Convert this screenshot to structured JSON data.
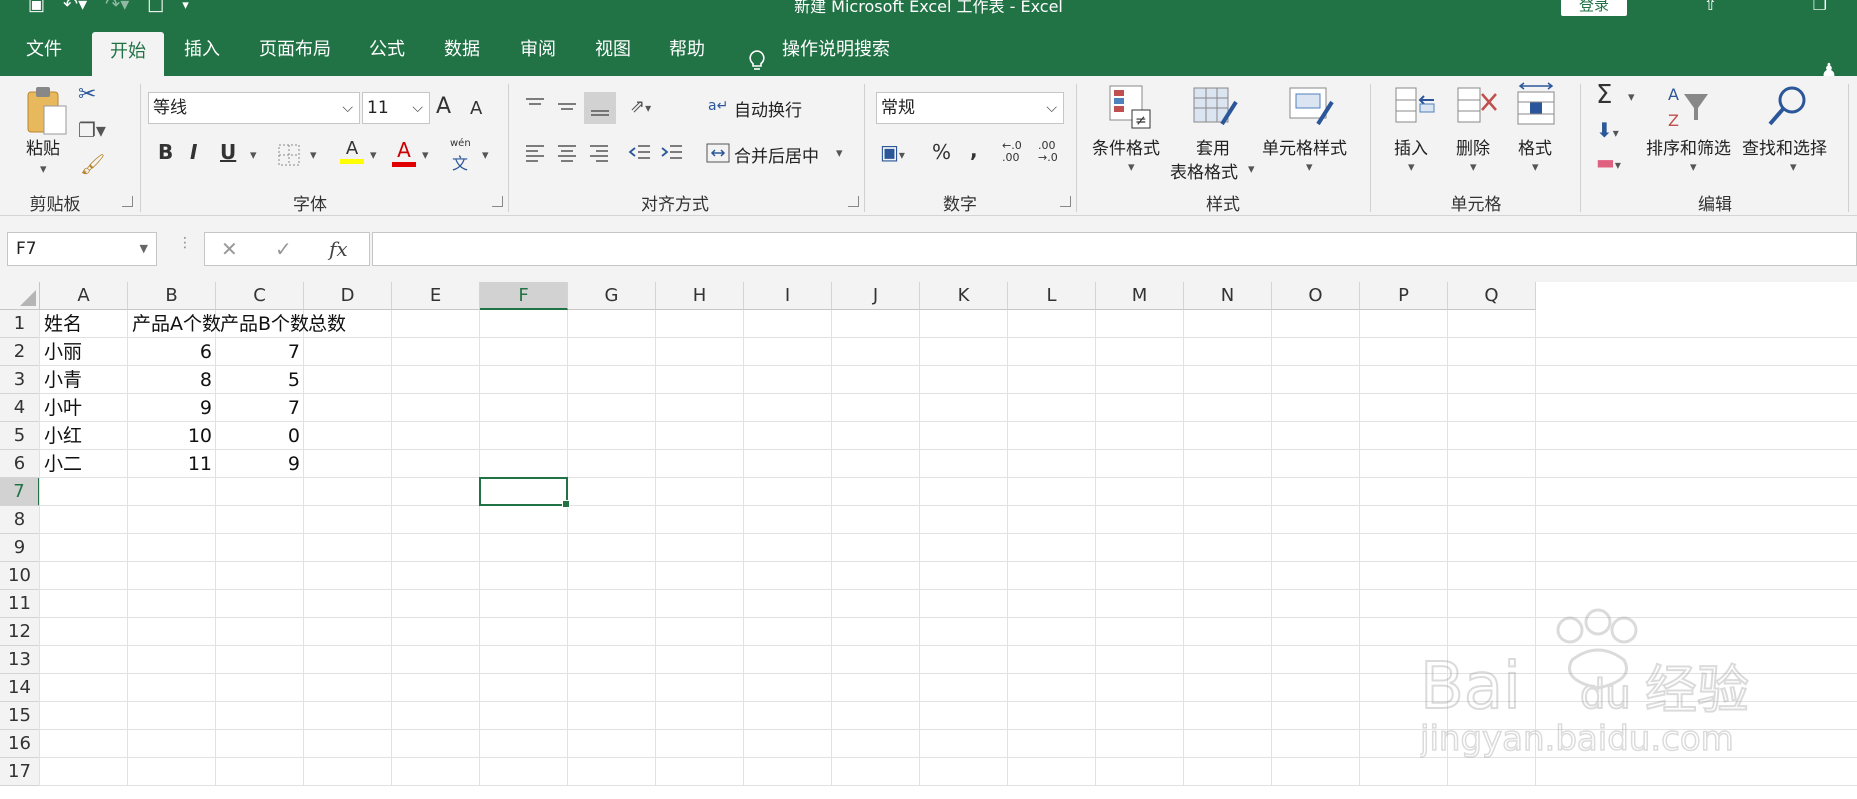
{
  "window": {
    "title": "新建 Microsoft Excel 工作表  -  Excel",
    "login_label": "登录"
  },
  "tabs": [
    {
      "label": "文件"
    },
    {
      "label": "开始"
    },
    {
      "label": "插入"
    },
    {
      "label": "页面布局"
    },
    {
      "label": "公式"
    },
    {
      "label": "数据"
    },
    {
      "label": "审阅"
    },
    {
      "label": "视图"
    },
    {
      "label": "帮助"
    },
    {
      "label": "操作说明搜索"
    }
  ],
  "active_tab": "开始",
  "ribbon": {
    "clipboard": {
      "paste": "粘贴",
      "group": "剪贴板"
    },
    "font": {
      "name": "等线",
      "size": "11",
      "grow": "A",
      "shrink": "A",
      "bold": "B",
      "italic": "I",
      "underline": "U",
      "fill": "A",
      "color": "A",
      "phonetic_top": "wén",
      "phonetic": "文",
      "group": "字体"
    },
    "alignment": {
      "wrap": "自动换行",
      "merge": "合并后居中",
      "group": "对齐方式"
    },
    "number": {
      "format": "常规",
      "percent": "%",
      "comma": ",",
      "inc_decimal": "←.0\n.00",
      "dec_decimal": ".00\n→.0",
      "group": "数字"
    },
    "styles": {
      "conditional": "条件格式",
      "table_top": "套用",
      "table_bottom": "表格格式",
      "cell_styles": "单元格样式",
      "group": "样式"
    },
    "cells": {
      "insert": "插入",
      "delete": "删除",
      "format": "格式",
      "group": "单元格"
    },
    "editing": {
      "sum": "Σ",
      "sort": "排序和筛选",
      "find": "查找和选择",
      "group": "编辑"
    }
  },
  "formula_bar": {
    "name_box": "F7",
    "fx": "fx",
    "cancel": "✕",
    "enter": "✓",
    "formula": ""
  },
  "sheet": {
    "columns": [
      "A",
      "B",
      "C",
      "D",
      "E",
      "F",
      "G",
      "H",
      "I",
      "J",
      "K",
      "L",
      "M",
      "N",
      "O",
      "P",
      "Q"
    ],
    "rows": [
      "1",
      "2",
      "3",
      "4",
      "5",
      "6",
      "7",
      "8",
      "9",
      "10",
      "11",
      "12",
      "13",
      "14",
      "15",
      "16",
      "17"
    ],
    "selected_col": "F",
    "selected_row": "7",
    "data": [
      [
        "姓名",
        "产品A个数",
        "产品B个数",
        "总数"
      ],
      [
        "小丽",
        "6",
        "7",
        ""
      ],
      [
        "小青",
        "8",
        "5",
        ""
      ],
      [
        "小叶",
        "9",
        "7",
        ""
      ],
      [
        "小红",
        "10",
        "0",
        ""
      ],
      [
        "小二",
        "11",
        "9",
        ""
      ]
    ]
  },
  "watermark": {
    "brand": "Bai",
    "brand2": "du",
    "cn": "经验",
    "url": "jingyan.baidu.com"
  }
}
